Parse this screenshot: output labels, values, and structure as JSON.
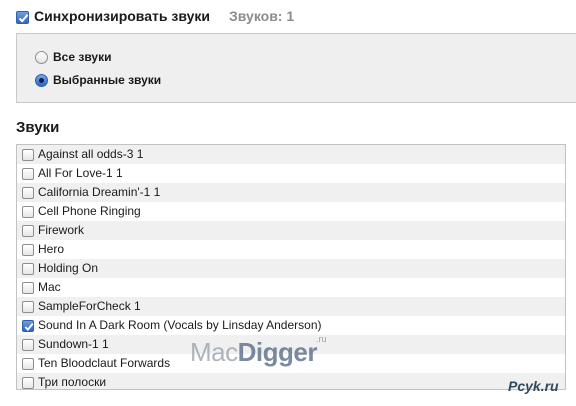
{
  "header": {
    "sync_label": "Синхронизировать звуки",
    "sync_checked": true,
    "count_label": "Звуков: 1"
  },
  "options": {
    "all_label": "Все звуки",
    "selected_label": "Выбранные звуки",
    "current": "selected"
  },
  "sounds": {
    "title": "Звуки",
    "items": [
      {
        "label": "Against all odds-3 1",
        "checked": false
      },
      {
        "label": "All For Love-1 1",
        "checked": false
      },
      {
        "label": "California Dreamin'-1 1",
        "checked": false
      },
      {
        "label": "Cell Phone Ringing",
        "checked": false
      },
      {
        "label": "Firework",
        "checked": false
      },
      {
        "label": "Hero",
        "checked": false
      },
      {
        "label": "Holding On",
        "checked": false
      },
      {
        "label": "Mac",
        "checked": false
      },
      {
        "label": "SampleForCheck 1",
        "checked": false
      },
      {
        "label": "Sound In A Dark Room (Vocals by Linsday Anderson)",
        "checked": true
      },
      {
        "label": "Sundown-1 1",
        "checked": false
      },
      {
        "label": "Ten Bloodclaut Forwards",
        "checked": false
      },
      {
        "label": "Три полоски",
        "checked": false
      }
    ]
  },
  "watermark": {
    "part1": "Mac",
    "part2": "Digger",
    "suffix": ".ru"
  },
  "corner_logo": "Pcyk.ru",
  "colors": {
    "accent": "#2e66c4",
    "count_text": "#8c8c8c",
    "alt_row": "#f0f0f0"
  }
}
